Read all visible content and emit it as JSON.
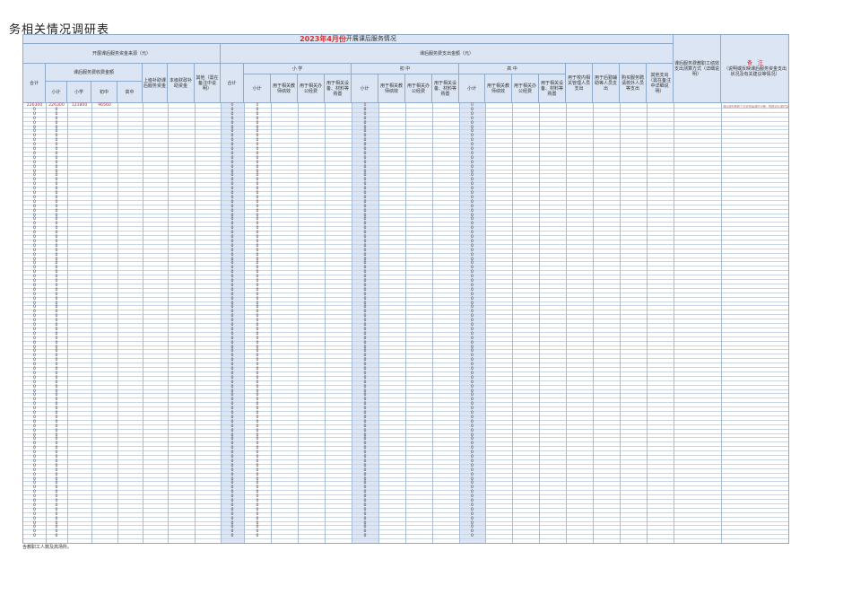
{
  "title": "务相关情况调研表",
  "sheet": {
    "header_month": "2023年4月份",
    "header_rest": "开展课后服务情况",
    "source_group": "开展课后服务资金来源（元）",
    "expense_group": "课后服务费支出金额（元）",
    "total": "合计",
    "fee_group": "课后服务费收费金额",
    "fee_sub": [
      "小计",
      "小学",
      "初中",
      "高中"
    ],
    "gov_subsidy": "上级补助课后服务资金",
    "local_subsidy": "本级财政补助资金",
    "other_source": "其他（需在备注中说明）",
    "expense_total": "合计",
    "primary": "小 学",
    "junior": "初 中",
    "senior": "高 中",
    "stage_sub": [
      "小计",
      "用于相关教师绩效",
      "用于相关办公经费",
      "用于相关设备、材料等购置"
    ],
    "teacher_mgmt": "用于校内相关管理人员支出",
    "external_staff": "用于后勤辅助等人员支出",
    "hire_external": "购买服务聘请校外人员等支出",
    "other_expense": "其他支出（需在备注中详细说明）",
    "salary_status": "课后服务费教职工绩效支出测算方式（详细说明）",
    "remark_title": "备　注",
    "remark_desc": "（说明或反映课后服务资金支出状况及有关建议等情况）"
  },
  "first_row": {
    "total": "226300",
    "fee_subtotal": "226300",
    "primary": "121800",
    "junior": "96560",
    "expense_total": "0",
    "primary_subtotal": "0",
    "junior_subtotal": "0",
    "senior_subtotal": "0",
    "note": "课后服务教职工绩效按每课时计酬，根据实际课时量核算发放给相关教职工……"
  },
  "zero": "0",
  "footer": "含教职工人数及高场所。"
}
